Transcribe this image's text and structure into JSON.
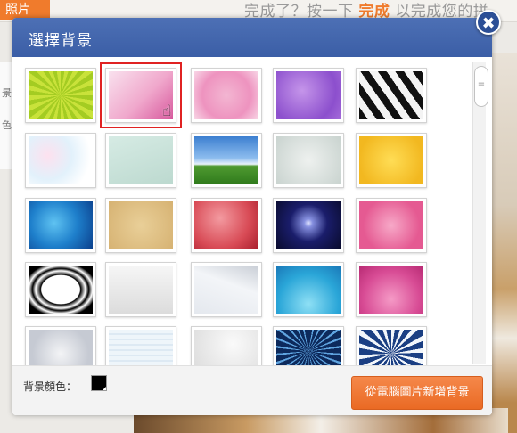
{
  "background_app": {
    "tab_label": "照片",
    "left_labels": [
      "景",
      "色"
    ],
    "instruction": {
      "prefix": "完成了？按一下",
      "highlight": "完成",
      "suffix": "以完成您的拼"
    }
  },
  "dialog": {
    "title": "選擇背景",
    "close_label": "✖",
    "scroll_grip": "=",
    "selected_index": 1,
    "backgrounds": [
      {
        "name": "bg-green-sunburst"
      },
      {
        "name": "bg-pink-gradient"
      },
      {
        "name": "bg-pink-floral"
      },
      {
        "name": "bg-purple-texture"
      },
      {
        "name": "bg-black-white-stripes"
      },
      {
        "name": "bg-pastel-watercolor"
      },
      {
        "name": "bg-mint-grain"
      },
      {
        "name": "bg-sky-grass"
      },
      {
        "name": "bg-grey-mist"
      },
      {
        "name": "bg-yellow-grunge"
      },
      {
        "name": "bg-blue-radial"
      },
      {
        "name": "bg-tan-parchment"
      },
      {
        "name": "bg-red-glow"
      },
      {
        "name": "bg-night-heart"
      },
      {
        "name": "bg-pink-stars"
      },
      {
        "name": "bg-zebra-frame"
      },
      {
        "name": "bg-white-texture"
      },
      {
        "name": "bg-white-floral-corner"
      },
      {
        "name": "bg-blue-sunburst"
      },
      {
        "name": "bg-pink-sunburst"
      },
      {
        "name": "bg-faded-collage"
      },
      {
        "name": "bg-light-lines"
      },
      {
        "name": "bg-grey-paper"
      },
      {
        "name": "bg-dark-rays"
      },
      {
        "name": "bg-navy-burst"
      }
    ],
    "footer": {
      "color_label": "背景顏色：",
      "color_value": "#000000",
      "add_button_label": "從電腦圖片新增背景"
    }
  },
  "colors": {
    "header": "#3f62a9",
    "accent": "#f07b2c",
    "selection": "#e02222"
  }
}
